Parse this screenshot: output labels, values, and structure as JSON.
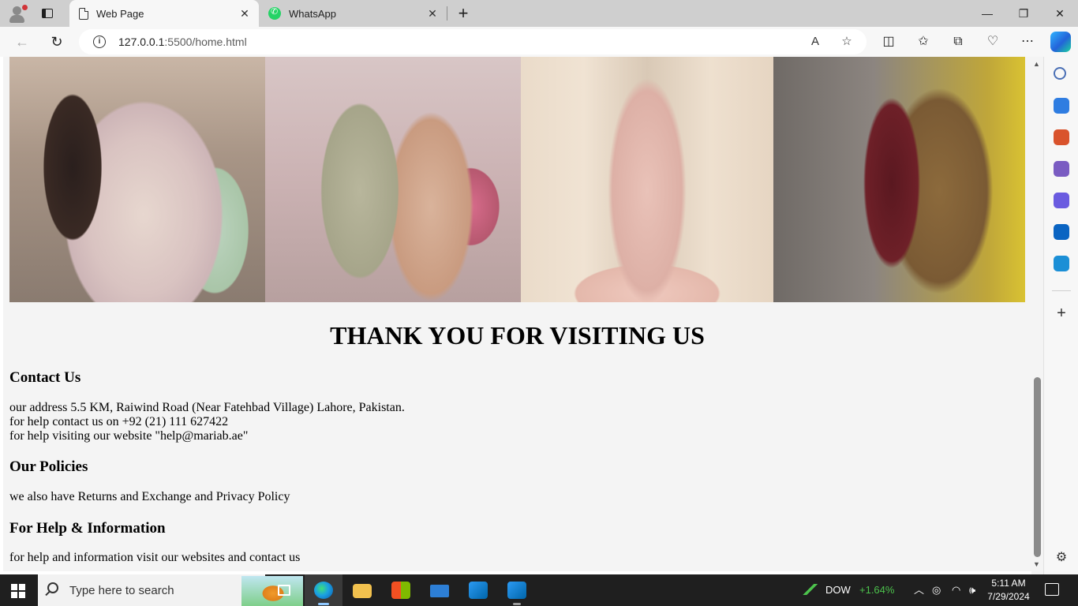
{
  "browser": {
    "tabs": [
      {
        "title": "Web Page",
        "icon": "document-icon",
        "active": true
      },
      {
        "title": "WhatsApp",
        "icon": "whatsapp-icon",
        "active": false
      }
    ],
    "tab_close_glyph": "✕",
    "new_tab_glyph": "+",
    "window_controls": {
      "minimize": "—",
      "restore": "❐",
      "close": "✕"
    },
    "nav": {
      "back": "←",
      "reload": "↻"
    },
    "address": {
      "host": "127.0.0.1",
      "path": ":5500/home.html",
      "info_glyph": "i"
    },
    "address_actions": {
      "read_aloud": "A",
      "favorite": "☆"
    },
    "toolbar_icons": {
      "split_screen": "◫",
      "favorites": "✩",
      "collections": "⧉",
      "browser_essentials": "♡",
      "more": "⋯"
    }
  },
  "page": {
    "gallery": [
      {
        "alt": "Embroidered pastel floral lawn suit with dupatta"
      },
      {
        "alt": "Sage green embroidered outfit with peach dupatta"
      },
      {
        "alt": "Blush pink embroidered maxi gown"
      },
      {
        "alt": "Maroon suit with golden dupatta"
      }
    ],
    "heading": "THANK YOU FOR VISITING US",
    "contact": {
      "title": "Contact Us",
      "lines": [
        "our address 5.5 KM, Raiwind Road (Near Fatehbad Village) Lahore, Pakistan.",
        "for help contact us on +92 (21) 111 627422",
        "for help visiting our website \"help@mariab.ae\""
      ]
    },
    "policies": {
      "title": "Our Policies",
      "text": "we also have Returns and Exchange and Privacy Policy"
    },
    "help": {
      "title": "For Help & Information",
      "text": "for help and information visit our websites and contact us"
    },
    "scroll_arrows": {
      "up": "▲",
      "down": "▼"
    }
  },
  "sidebar": {
    "items": [
      {
        "name": "search",
        "color": "#4a6fb5"
      },
      {
        "name": "shopping",
        "color": "#2f7de1"
      },
      {
        "name": "tools",
        "color": "#d9532c"
      },
      {
        "name": "games",
        "color": "#7a5cc2"
      },
      {
        "name": "copilot-app",
        "color": "#6a5be0"
      },
      {
        "name": "outlook",
        "color": "#0a64c2"
      },
      {
        "name": "send",
        "color": "#1b8fd6"
      }
    ],
    "add_glyph": "+",
    "settings_glyph": "⚙"
  },
  "taskbar": {
    "search_placeholder": "Type here to search",
    "apps": [
      {
        "name": "task-view",
        "color": "#ffffff",
        "state": "none"
      },
      {
        "name": "edge",
        "color": "#1ba0e2",
        "state": "active"
      },
      {
        "name": "file-explorer",
        "color": "#f2c14e",
        "state": "none"
      },
      {
        "name": "microsoft-store",
        "color": "#3a8ee6",
        "state": "none"
      },
      {
        "name": "mail",
        "color": "#2d7fd6",
        "state": "none"
      },
      {
        "name": "vs-code",
        "color": "#2b9af3",
        "state": "none"
      },
      {
        "name": "vs-code-2",
        "color": "#2b9af3",
        "state": "open"
      }
    ],
    "stock": {
      "ticker": "DOW",
      "change": "+1.64%",
      "change_color": "#4cc24c"
    },
    "tray_glyphs": {
      "chevron": "︿",
      "camera": "◎",
      "wifi": "◠",
      "volume": "🕪"
    },
    "time": "5:11 AM",
    "date": "7/29/2024"
  }
}
